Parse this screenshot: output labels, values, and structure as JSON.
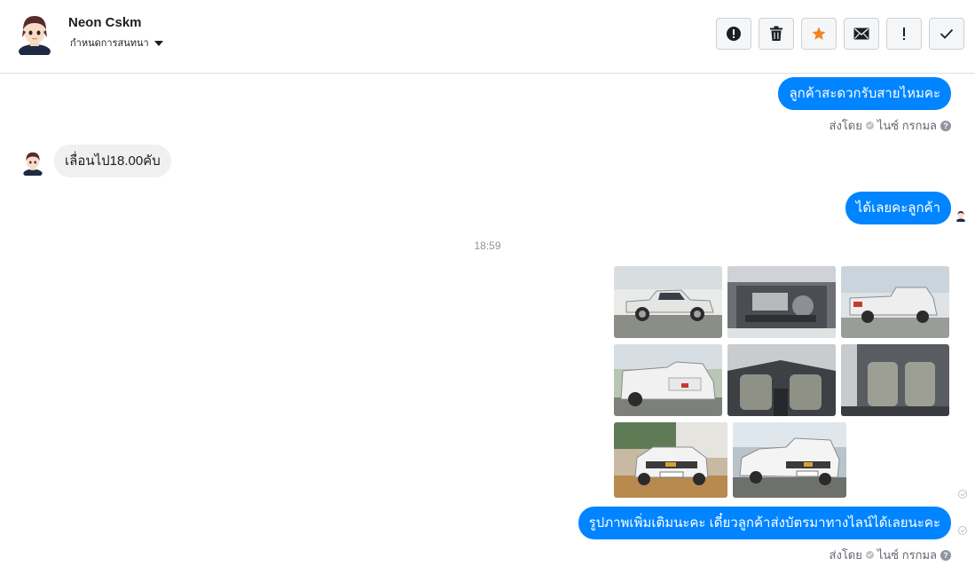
{
  "header": {
    "contact_name": "Neon Cskm",
    "assign_label": "กำหนดการสนทนา"
  },
  "toolbar": {
    "buttons": [
      {
        "name": "report-spam",
        "icon": "alert-circle-icon"
      },
      {
        "name": "delete",
        "icon": "trash-icon"
      },
      {
        "name": "star",
        "icon": "star-icon"
      },
      {
        "name": "mark-unread",
        "icon": "envelope-icon"
      },
      {
        "name": "flag-important",
        "icon": "exclamation-icon"
      },
      {
        "name": "mark-done",
        "icon": "check-icon"
      }
    ]
  },
  "messages": {
    "m1": {
      "text": "ลูกค้าสะดวกรับสายไหมคะ"
    },
    "m1_meta": {
      "sent_by": "ส่งโดย",
      "agent": "ไนซ์ กรกมล"
    },
    "m2": {
      "text": "เลื่อนไป18.00คับ"
    },
    "m3": {
      "text": "ได้เลยคะลูกค้า"
    },
    "time_divider": "18:59",
    "m5": {
      "text": "รูปภาพเพิ่มเติมนะคะ เดี๋ยวลูกค้าส่งบัตรมาทางไลน์ได้เลยนะคะ"
    },
    "m5_meta": {
      "sent_by": "ส่งโดย",
      "agent": "ไนซ์ กรกมล"
    }
  },
  "colors": {
    "accent": "#0084ff",
    "incoming_bubble": "#f1f0f0",
    "star": "#f58220"
  }
}
